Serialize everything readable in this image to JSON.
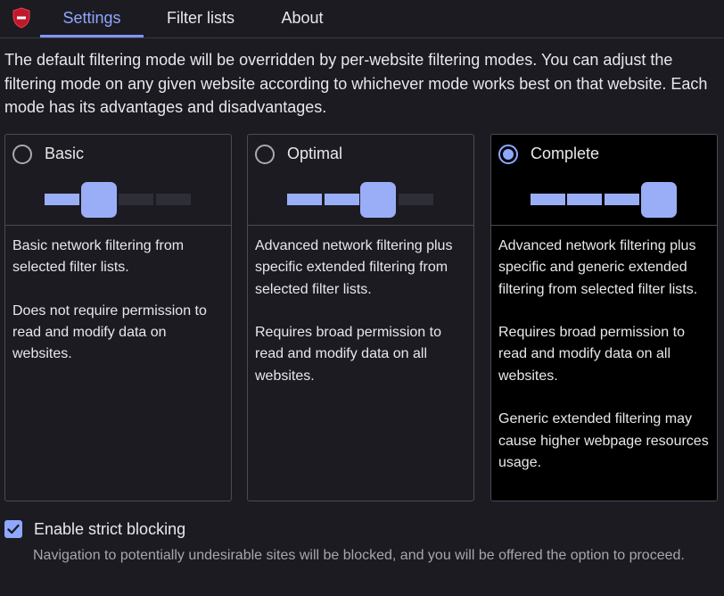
{
  "tabs": [
    {
      "label": "Settings",
      "active": true
    },
    {
      "label": "Filter lists",
      "active": false
    },
    {
      "label": "About",
      "active": false
    }
  ],
  "intro": "The default filtering mode will be overridden by per-website filtering modes. You can adjust the filtering mode on any given website according to whichever mode works best on that website. Each mode has its advantages and disadvantages.",
  "modes": [
    {
      "title": "Basic",
      "selected": false,
      "level": 2,
      "paragraphs": [
        "Basic network filtering from selected filter lists.",
        "Does not require permission to read and modify data on websites."
      ]
    },
    {
      "title": "Optimal",
      "selected": false,
      "level": 3,
      "paragraphs": [
        "Advanced network filtering plus specific extended filtering from selected filter lists.",
        "Requires broad permission to read and modify data on all websites."
      ]
    },
    {
      "title": "Complete",
      "selected": true,
      "level": 4,
      "paragraphs": [
        "Advanced network filtering plus specific and generic extended filtering from selected filter lists.",
        "Requires broad permission to read and modify data on all websites.",
        "Generic extended filtering may cause higher webpage resources usage."
      ]
    }
  ],
  "strict_blocking": {
    "label": "Enable strict blocking",
    "checked": true,
    "description": "Navigation to potentially undesirable sites will be blocked, and you will be offered the option to proceed."
  },
  "colors": {
    "background": "#1c1b22",
    "accent": "#8fa8ff",
    "selected_card": "#000000",
    "logo_red": "#c0182a"
  },
  "icons": {
    "logo": "ublock-shield-icon",
    "check": "check-icon"
  }
}
